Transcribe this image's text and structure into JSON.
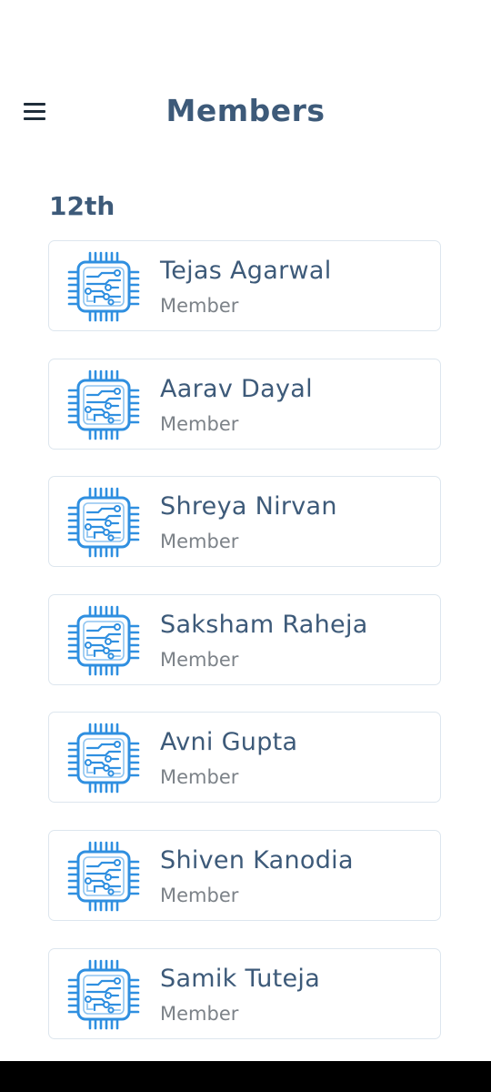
{
  "header": {
    "title": "Members",
    "menu_icon": "hamburger-menu-icon"
  },
  "section": {
    "title": "12th"
  },
  "members": [
    {
      "name": "Tejas Agarwal",
      "role": "Member",
      "icon": "circuit-chip-icon"
    },
    {
      "name": "Aarav Dayal",
      "role": "Member",
      "icon": "circuit-chip-icon"
    },
    {
      "name": "Shreya Nirvan",
      "role": "Member",
      "icon": "circuit-chip-icon"
    },
    {
      "name": "Saksham Raheja",
      "role": "Member",
      "icon": "circuit-chip-icon"
    },
    {
      "name": "Avni Gupta",
      "role": "Member",
      "icon": "circuit-chip-icon"
    },
    {
      "name": "Shiven Kanodia",
      "role": "Member",
      "icon": "circuit-chip-icon"
    },
    {
      "name": "Samik Tuteja",
      "role": "Member",
      "icon": "circuit-chip-icon"
    }
  ],
  "colors": {
    "accent": "#3d5a79",
    "icon_blue": "#2f8fe0",
    "secondary_text": "#7c8288",
    "card_border": "#dde6ee"
  }
}
